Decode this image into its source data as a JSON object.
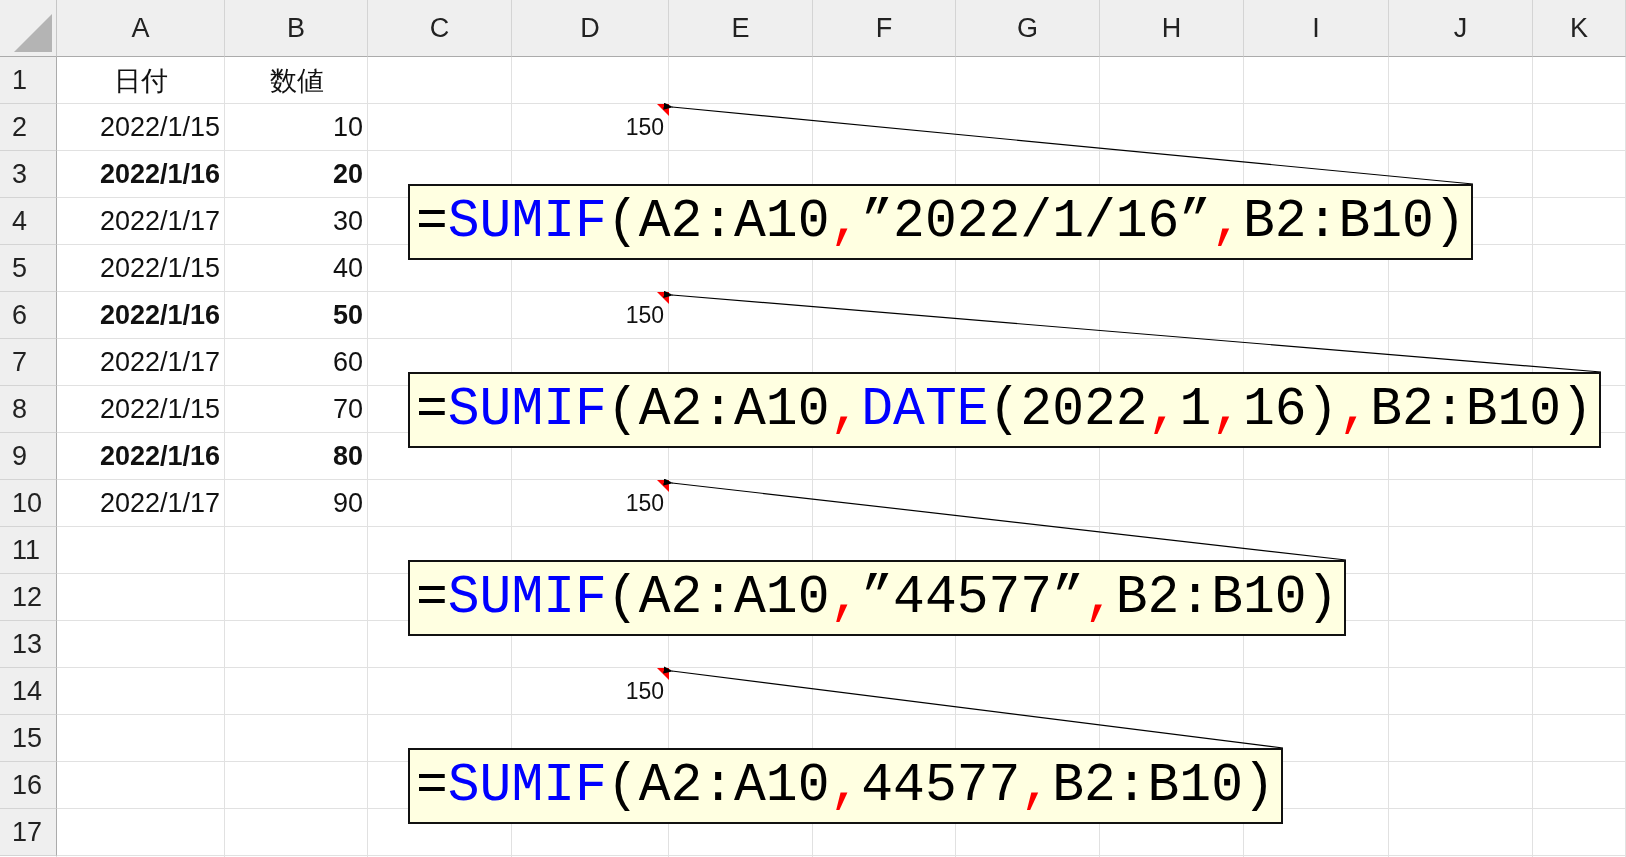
{
  "columns": [
    "A",
    "B",
    "C",
    "D",
    "E",
    "F",
    "G",
    "H",
    "I",
    "J",
    "K"
  ],
  "rows": [
    {
      "header": "1",
      "date": {
        "text": "日付",
        "bold": false,
        "heading": true
      },
      "value": {
        "text": "数値",
        "bold": false,
        "heading": true
      }
    },
    {
      "header": "2",
      "date": {
        "text": "2022/1/15",
        "bold": false
      },
      "value": {
        "text": "10",
        "bold": false
      },
      "result": {
        "text": "150",
        "comment": [
          {
            "kind": "text",
            "text": "="
          },
          {
            "kind": "function",
            "text": "SUMIF"
          },
          {
            "kind": "text",
            "text": "(A2:A10"
          },
          {
            "kind": "separator",
            "text": ","
          },
          {
            "kind": "text",
            "text": "”2022/1/16”"
          },
          {
            "kind": "separator",
            "text": ","
          },
          {
            "kind": "text",
            "text": "B2:B10)"
          }
        ]
      }
    },
    {
      "header": "3",
      "date": {
        "text": "2022/1/16",
        "bold": true
      },
      "value": {
        "text": "20",
        "bold": true
      }
    },
    {
      "header": "4",
      "date": {
        "text": "2022/1/17",
        "bold": false
      },
      "value": {
        "text": "30",
        "bold": false
      }
    },
    {
      "header": "5",
      "date": {
        "text": "2022/1/15",
        "bold": false
      },
      "value": {
        "text": "40",
        "bold": false
      }
    },
    {
      "header": "6",
      "date": {
        "text": "2022/1/16",
        "bold": true
      },
      "value": {
        "text": "50",
        "bold": true
      },
      "result": {
        "text": "150",
        "comment": [
          {
            "kind": "text",
            "text": "="
          },
          {
            "kind": "function",
            "text": "SUMIF"
          },
          {
            "kind": "text",
            "text": "(A2:A10"
          },
          {
            "kind": "separator",
            "text": ","
          },
          {
            "kind": "function",
            "text": "DATE"
          },
          {
            "kind": "text",
            "text": "(2022"
          },
          {
            "kind": "separator",
            "text": ","
          },
          {
            "kind": "text",
            "text": "1"
          },
          {
            "kind": "separator",
            "text": ","
          },
          {
            "kind": "text",
            "text": "16)"
          },
          {
            "kind": "separator",
            "text": ","
          },
          {
            "kind": "text",
            "text": "B2:B10)"
          }
        ]
      }
    },
    {
      "header": "7",
      "date": {
        "text": "2022/1/17",
        "bold": false
      },
      "value": {
        "text": "60",
        "bold": false
      }
    },
    {
      "header": "8",
      "date": {
        "text": "2022/1/15",
        "bold": false
      },
      "value": {
        "text": "70",
        "bold": false
      }
    },
    {
      "header": "9",
      "date": {
        "text": "2022/1/16",
        "bold": true
      },
      "value": {
        "text": "80",
        "bold": true
      }
    },
    {
      "header": "10",
      "date": {
        "text": "2022/1/17",
        "bold": false
      },
      "value": {
        "text": "90",
        "bold": false
      },
      "result": {
        "text": "150",
        "comment": [
          {
            "kind": "text",
            "text": "="
          },
          {
            "kind": "function",
            "text": "SUMIF"
          },
          {
            "kind": "text",
            "text": "(A2:A10"
          },
          {
            "kind": "separator",
            "text": ","
          },
          {
            "kind": "text",
            "text": "”44577”"
          },
          {
            "kind": "separator",
            "text": ","
          },
          {
            "kind": "text",
            "text": "B2:B10)"
          }
        ]
      }
    },
    {
      "header": "11"
    },
    {
      "header": "12"
    },
    {
      "header": "13"
    },
    {
      "header": "14",
      "result": {
        "text": "150",
        "comment": [
          {
            "kind": "text",
            "text": "="
          },
          {
            "kind": "function",
            "text": "SUMIF"
          },
          {
            "kind": "text",
            "text": "(A2:A10"
          },
          {
            "kind": "separator",
            "text": ","
          },
          {
            "kind": "text",
            "text": "44577"
          },
          {
            "kind": "separator",
            "text": ","
          },
          {
            "kind": "text",
            "text": "B2:B10)"
          }
        ]
      }
    },
    {
      "header": "15"
    },
    {
      "header": "16"
    },
    {
      "header": "17"
    }
  ]
}
